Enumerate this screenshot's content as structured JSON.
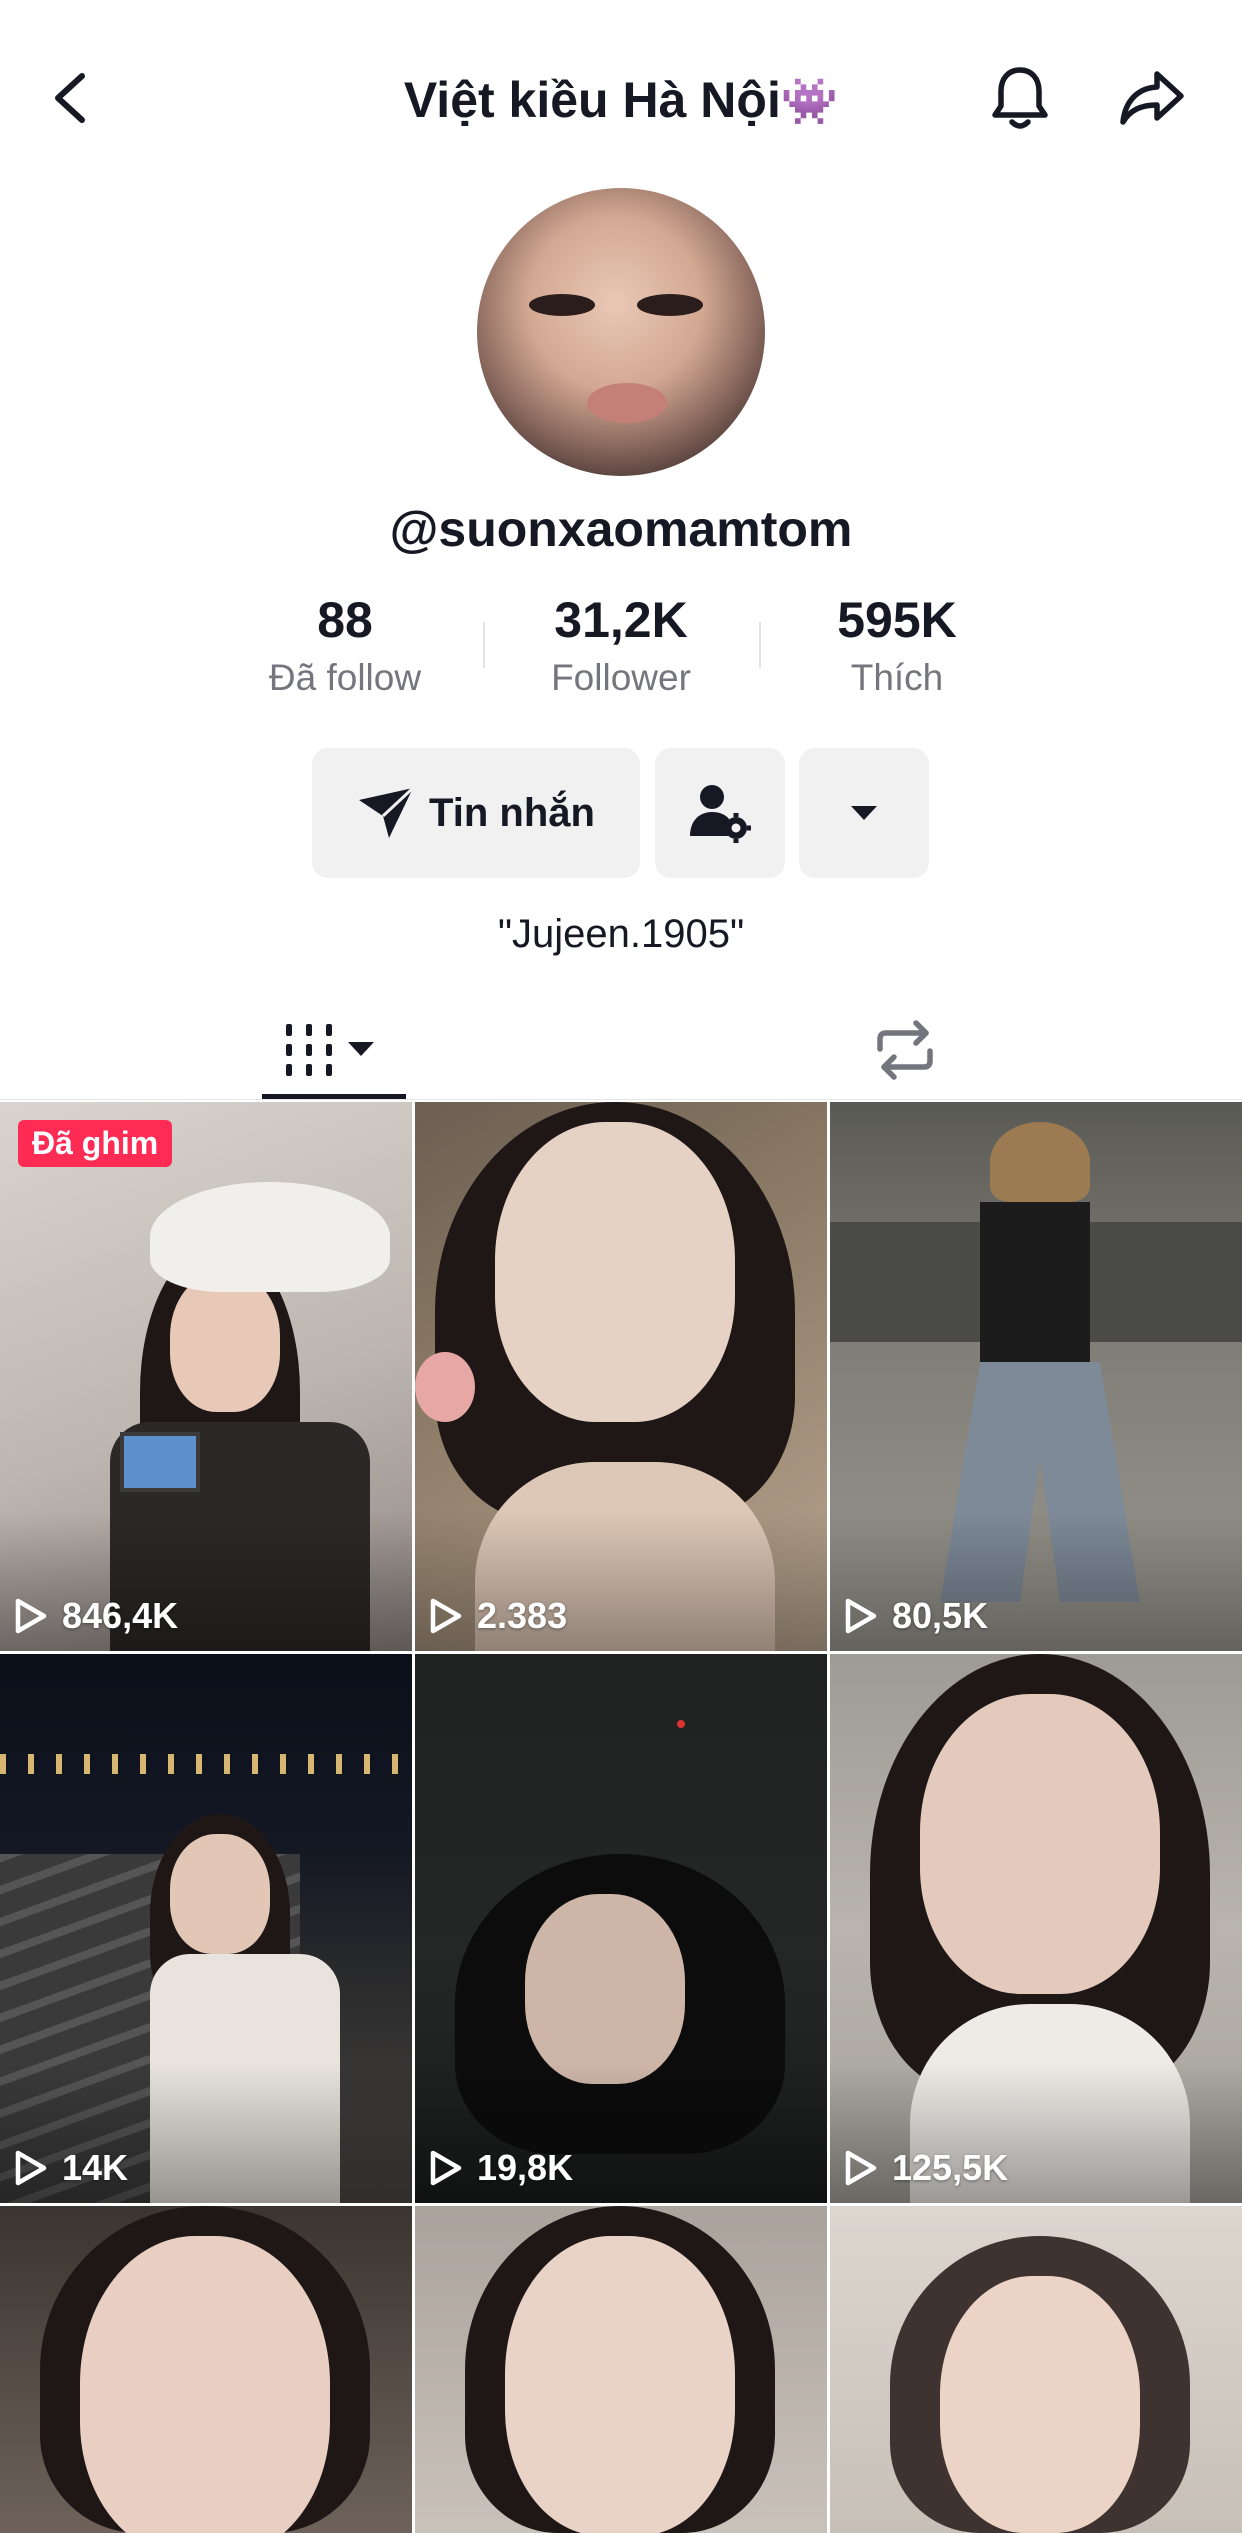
{
  "header": {
    "title": "Việt kiều Hà Nội",
    "title_emoji": "👾"
  },
  "profile": {
    "username": "@suonxaomamtom",
    "bio": "\"Jujeen.1905\""
  },
  "stats": [
    {
      "value": "88",
      "label": "Đã follow"
    },
    {
      "value": "31,2K",
      "label": "Follower"
    },
    {
      "value": "595K",
      "label": "Thích"
    }
  ],
  "actions": {
    "message_label": "Tin nhắn"
  },
  "tabs": {
    "videos": "videos-grid",
    "reposts": "reposts"
  },
  "videos": [
    {
      "views": "846,4K",
      "pinned_label": "Đã ghim"
    },
    {
      "views": "2.383"
    },
    {
      "views": "80,5K"
    },
    {
      "views": "14K"
    },
    {
      "views": "19,8K"
    },
    {
      "views": "125,5K"
    },
    {
      "views": ""
    },
    {
      "views": ""
    },
    {
      "views": ""
    }
  ],
  "colors": {
    "accent": "#fe2c55",
    "text": "#161823",
    "secondary_text": "#75757d",
    "button_bg": "#f1f1f2"
  }
}
